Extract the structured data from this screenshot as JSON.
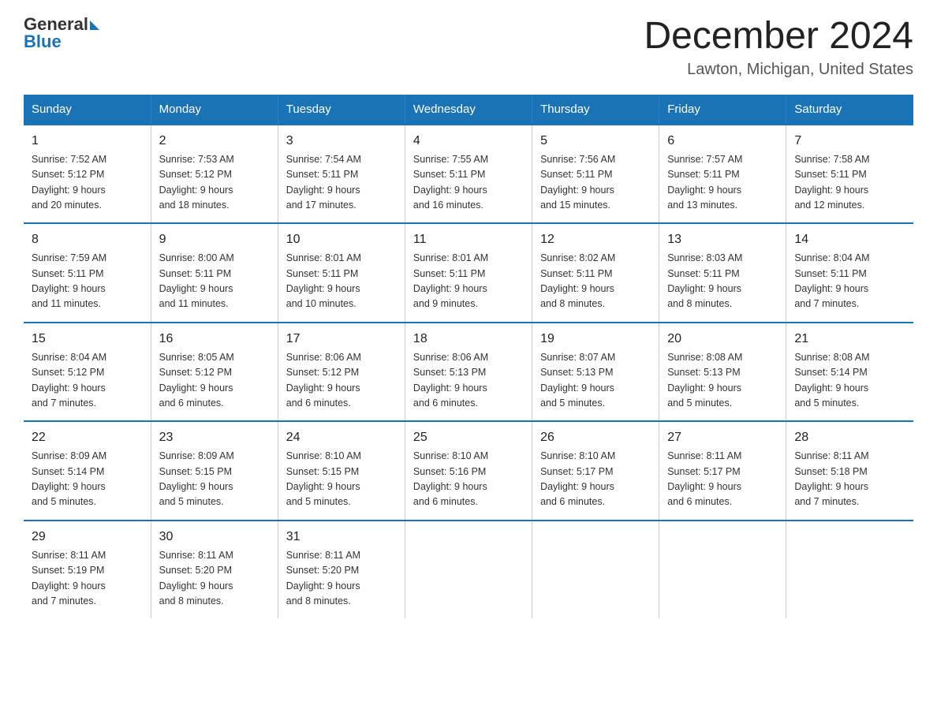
{
  "header": {
    "logo_general": "General",
    "logo_blue": "Blue",
    "month_title": "December 2024",
    "location": "Lawton, Michigan, United States"
  },
  "days_of_week": [
    "Sunday",
    "Monday",
    "Tuesday",
    "Wednesday",
    "Thursday",
    "Friday",
    "Saturday"
  ],
  "weeks": [
    [
      {
        "day": "1",
        "sunrise": "7:52 AM",
        "sunset": "5:12 PM",
        "daylight": "9 hours and 20 minutes."
      },
      {
        "day": "2",
        "sunrise": "7:53 AM",
        "sunset": "5:12 PM",
        "daylight": "9 hours and 18 minutes."
      },
      {
        "day": "3",
        "sunrise": "7:54 AM",
        "sunset": "5:11 PM",
        "daylight": "9 hours and 17 minutes."
      },
      {
        "day": "4",
        "sunrise": "7:55 AM",
        "sunset": "5:11 PM",
        "daylight": "9 hours and 16 minutes."
      },
      {
        "day": "5",
        "sunrise": "7:56 AM",
        "sunset": "5:11 PM",
        "daylight": "9 hours and 15 minutes."
      },
      {
        "day": "6",
        "sunrise": "7:57 AM",
        "sunset": "5:11 PM",
        "daylight": "9 hours and 13 minutes."
      },
      {
        "day": "7",
        "sunrise": "7:58 AM",
        "sunset": "5:11 PM",
        "daylight": "9 hours and 12 minutes."
      }
    ],
    [
      {
        "day": "8",
        "sunrise": "7:59 AM",
        "sunset": "5:11 PM",
        "daylight": "9 hours and 11 minutes."
      },
      {
        "day": "9",
        "sunrise": "8:00 AM",
        "sunset": "5:11 PM",
        "daylight": "9 hours and 11 minutes."
      },
      {
        "day": "10",
        "sunrise": "8:01 AM",
        "sunset": "5:11 PM",
        "daylight": "9 hours and 10 minutes."
      },
      {
        "day": "11",
        "sunrise": "8:01 AM",
        "sunset": "5:11 PM",
        "daylight": "9 hours and 9 minutes."
      },
      {
        "day": "12",
        "sunrise": "8:02 AM",
        "sunset": "5:11 PM",
        "daylight": "9 hours and 8 minutes."
      },
      {
        "day": "13",
        "sunrise": "8:03 AM",
        "sunset": "5:11 PM",
        "daylight": "9 hours and 8 minutes."
      },
      {
        "day": "14",
        "sunrise": "8:04 AM",
        "sunset": "5:11 PM",
        "daylight": "9 hours and 7 minutes."
      }
    ],
    [
      {
        "day": "15",
        "sunrise": "8:04 AM",
        "sunset": "5:12 PM",
        "daylight": "9 hours and 7 minutes."
      },
      {
        "day": "16",
        "sunrise": "8:05 AM",
        "sunset": "5:12 PM",
        "daylight": "9 hours and 6 minutes."
      },
      {
        "day": "17",
        "sunrise": "8:06 AM",
        "sunset": "5:12 PM",
        "daylight": "9 hours and 6 minutes."
      },
      {
        "day": "18",
        "sunrise": "8:06 AM",
        "sunset": "5:13 PM",
        "daylight": "9 hours and 6 minutes."
      },
      {
        "day": "19",
        "sunrise": "8:07 AM",
        "sunset": "5:13 PM",
        "daylight": "9 hours and 5 minutes."
      },
      {
        "day": "20",
        "sunrise": "8:08 AM",
        "sunset": "5:13 PM",
        "daylight": "9 hours and 5 minutes."
      },
      {
        "day": "21",
        "sunrise": "8:08 AM",
        "sunset": "5:14 PM",
        "daylight": "9 hours and 5 minutes."
      }
    ],
    [
      {
        "day": "22",
        "sunrise": "8:09 AM",
        "sunset": "5:14 PM",
        "daylight": "9 hours and 5 minutes."
      },
      {
        "day": "23",
        "sunrise": "8:09 AM",
        "sunset": "5:15 PM",
        "daylight": "9 hours and 5 minutes."
      },
      {
        "day": "24",
        "sunrise": "8:10 AM",
        "sunset": "5:15 PM",
        "daylight": "9 hours and 5 minutes."
      },
      {
        "day": "25",
        "sunrise": "8:10 AM",
        "sunset": "5:16 PM",
        "daylight": "9 hours and 6 minutes."
      },
      {
        "day": "26",
        "sunrise": "8:10 AM",
        "sunset": "5:17 PM",
        "daylight": "9 hours and 6 minutes."
      },
      {
        "day": "27",
        "sunrise": "8:11 AM",
        "sunset": "5:17 PM",
        "daylight": "9 hours and 6 minutes."
      },
      {
        "day": "28",
        "sunrise": "8:11 AM",
        "sunset": "5:18 PM",
        "daylight": "9 hours and 7 minutes."
      }
    ],
    [
      {
        "day": "29",
        "sunrise": "8:11 AM",
        "sunset": "5:19 PM",
        "daylight": "9 hours and 7 minutes."
      },
      {
        "day": "30",
        "sunrise": "8:11 AM",
        "sunset": "5:20 PM",
        "daylight": "9 hours and 8 minutes."
      },
      {
        "day": "31",
        "sunrise": "8:11 AM",
        "sunset": "5:20 PM",
        "daylight": "9 hours and 8 minutes."
      },
      {
        "day": "",
        "sunrise": "",
        "sunset": "",
        "daylight": ""
      },
      {
        "day": "",
        "sunrise": "",
        "sunset": "",
        "daylight": ""
      },
      {
        "day": "",
        "sunrise": "",
        "sunset": "",
        "daylight": ""
      },
      {
        "day": "",
        "sunrise": "",
        "sunset": "",
        "daylight": ""
      }
    ]
  ],
  "labels": {
    "sunrise": "Sunrise: ",
    "sunset": "Sunset: ",
    "daylight": "Daylight: "
  }
}
